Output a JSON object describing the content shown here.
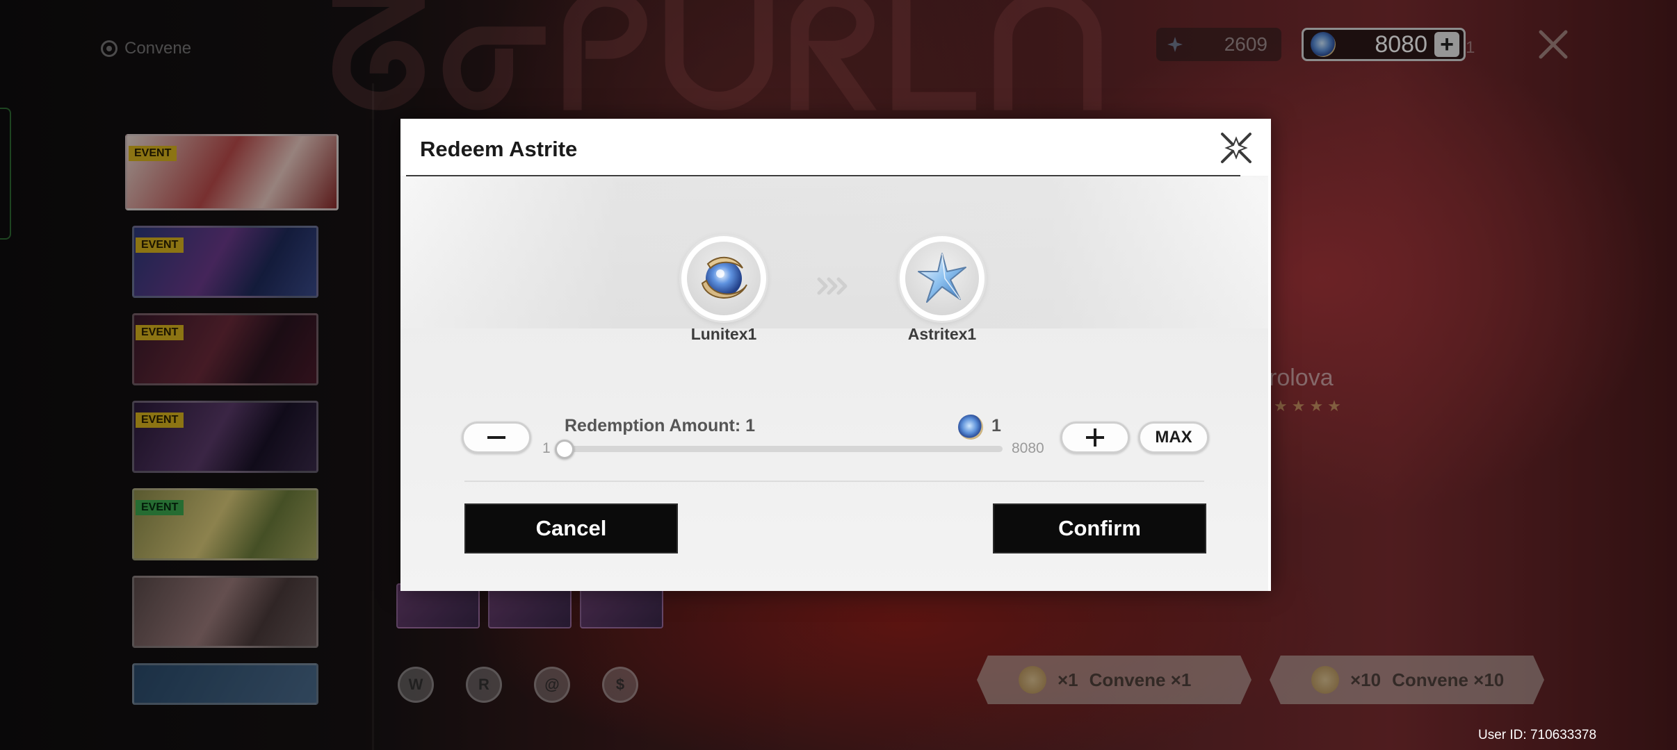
{
  "background": {
    "header_title": "Convene",
    "banner_tags": [
      "EVENT",
      "EVENT",
      "EVENT",
      "EVENT",
      "EVENT"
    ],
    "character_name": "rolova",
    "character_stars": "★★★★",
    "round_icons": [
      "W",
      "R",
      "@",
      "$"
    ],
    "currencies": {
      "astrite": "2609",
      "lunite": "8080",
      "trailing": "1"
    },
    "convene_buttons": [
      {
        "cost": "×1",
        "label": "Convene ×1"
      },
      {
        "cost": "×10",
        "label": "Convene ×10"
      }
    ],
    "user_id": "User ID: 710633378"
  },
  "dialog": {
    "title": "Redeem Astrite",
    "from_item": {
      "label": "Lunitex1",
      "icon": "lunite-icon"
    },
    "to_item": {
      "label": "Astritex1",
      "icon": "astrite-icon"
    },
    "redemption_label": "Redemption Amount: 1",
    "cost_value": "1",
    "slider": {
      "min_label": "1",
      "max_label": "8080",
      "value": 1,
      "min": 1,
      "max": 8080
    },
    "max_label": "MAX",
    "cancel_label": "Cancel",
    "confirm_label": "Confirm"
  },
  "colors": {
    "dialog_bg": "#f4f4f4",
    "button_dark": "#0b0b0b",
    "event_tag": "#d7b31e"
  }
}
